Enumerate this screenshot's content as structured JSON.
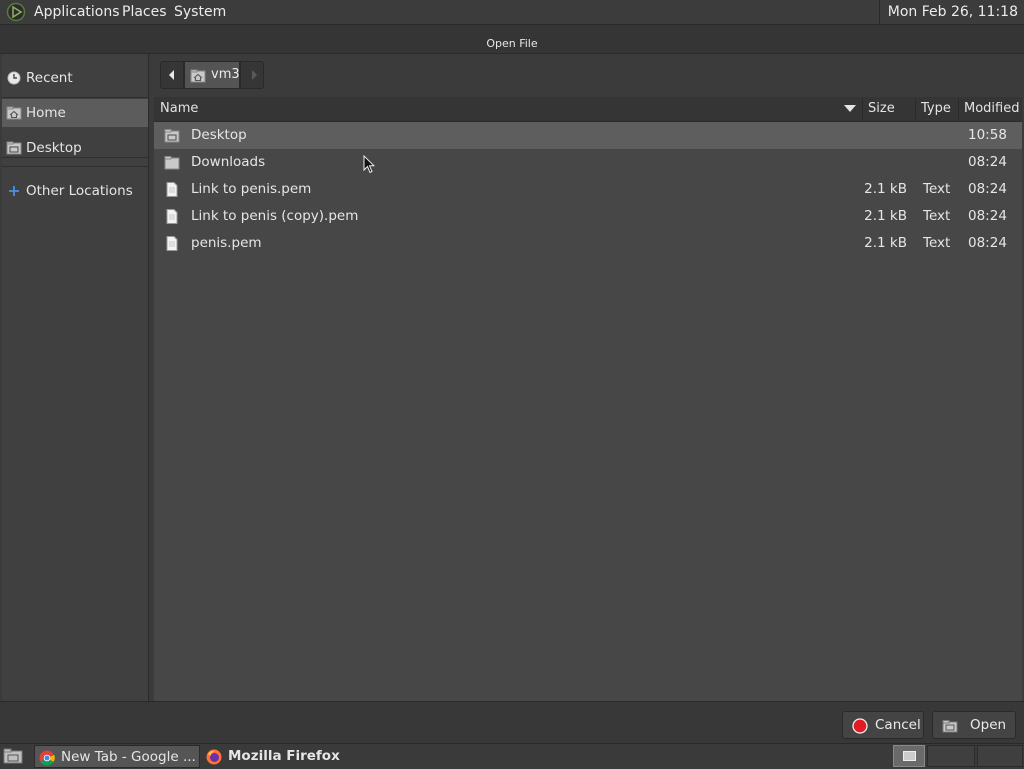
{
  "top_panel": {
    "menus": [
      "Applications",
      "Places",
      "System"
    ],
    "clock": "Mon Feb 26, 11:18"
  },
  "dialog": {
    "title": "Open File"
  },
  "sidebar": {
    "items": [
      {
        "label": "Recent",
        "icon": "clock-icon"
      },
      {
        "label": "Home",
        "icon": "home-icon"
      },
      {
        "label": "Desktop",
        "icon": "desktop-folder-icon"
      },
      {
        "label": "Other Locations",
        "icon": "plus-icon"
      }
    ]
  },
  "pathbar": {
    "crumb": "vm3"
  },
  "columns": {
    "name": "Name",
    "size": "Size",
    "type": "Type",
    "modified": "Modified"
  },
  "files": [
    {
      "name": "Desktop",
      "size": "",
      "type": "",
      "modified": "10:58",
      "icon": "desktop-folder-icon"
    },
    {
      "name": "Downloads",
      "size": "",
      "type": "",
      "modified": "08:24",
      "icon": "folder-icon"
    },
    {
      "name": "Link to penis.pem",
      "size": "2.1 kB",
      "type": "Text",
      "modified": "08:24",
      "icon": "text-file-icon"
    },
    {
      "name": "Link to penis (copy).pem",
      "size": "2.1 kB",
      "type": "Text",
      "modified": "08:24",
      "icon": "text-file-icon"
    },
    {
      "name": "penis.pem",
      "size": "2.1 kB",
      "type": "Text",
      "modified": "08:24",
      "icon": "text-file-icon"
    }
  ],
  "buttons": {
    "cancel": "Cancel",
    "open": "Open"
  },
  "taskbar": {
    "tasks": [
      {
        "label": "New Tab - Google ...",
        "icon": "chrome-icon"
      },
      {
        "label": "Mozilla Firefox",
        "icon": "firefox-icon"
      }
    ]
  }
}
